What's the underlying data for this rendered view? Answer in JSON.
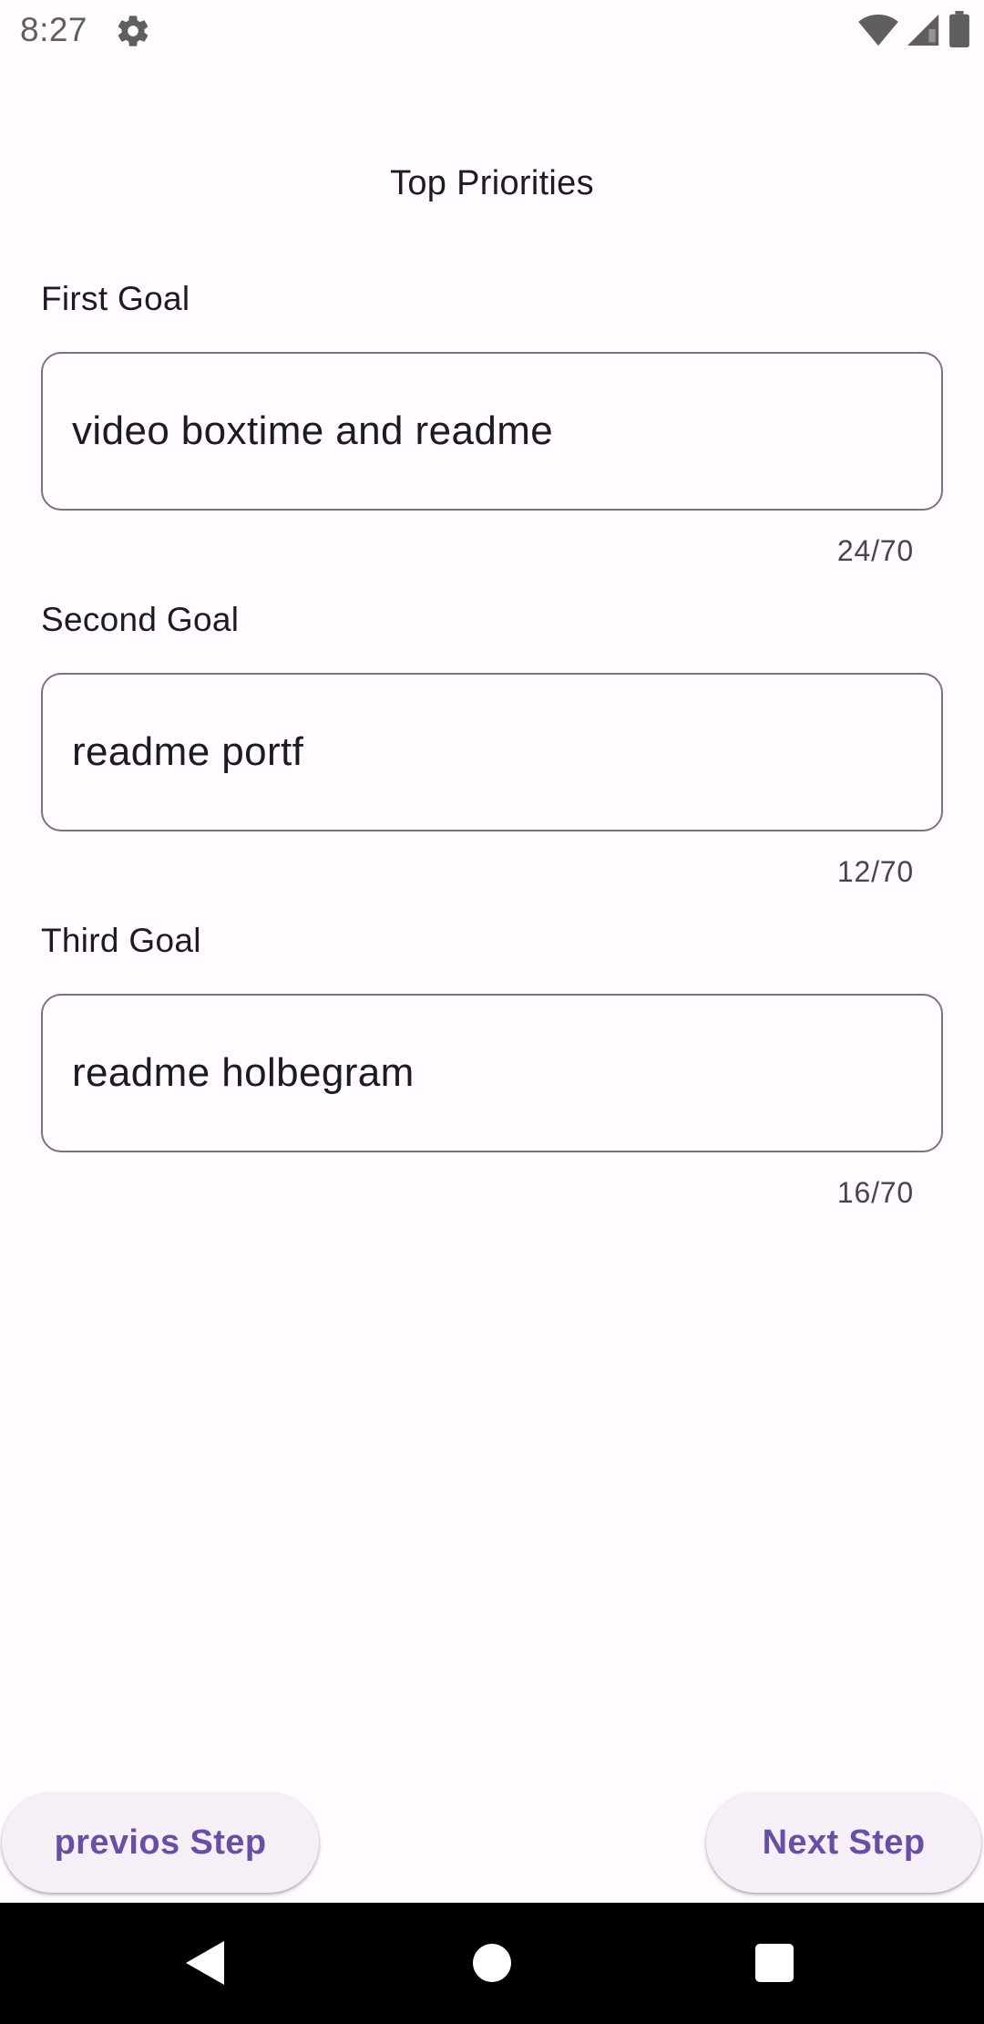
{
  "status_bar": {
    "time": "8:27",
    "icons": [
      "gear-icon",
      "wifi-icon",
      "signal-icon",
      "battery-icon"
    ]
  },
  "title": "Top Priorities",
  "goals": [
    {
      "label": "First Goal",
      "value": "video boxtime and readme",
      "counter": "24/70"
    },
    {
      "label": "Second Goal",
      "value": "readme portf",
      "counter": "12/70"
    },
    {
      "label": "Third Goal",
      "value": "readme holbegram",
      "counter": "16/70"
    }
  ],
  "buttons": {
    "previous_label": "previos Step",
    "next_label": "Next Step"
  },
  "navigation": {
    "icons": [
      "back-icon",
      "home-icon",
      "recents-icon"
    ]
  },
  "colors": {
    "background": "#fffbfe",
    "accent": "#6750a4",
    "button_background": "#f6eff8",
    "outline": "#79747e"
  }
}
